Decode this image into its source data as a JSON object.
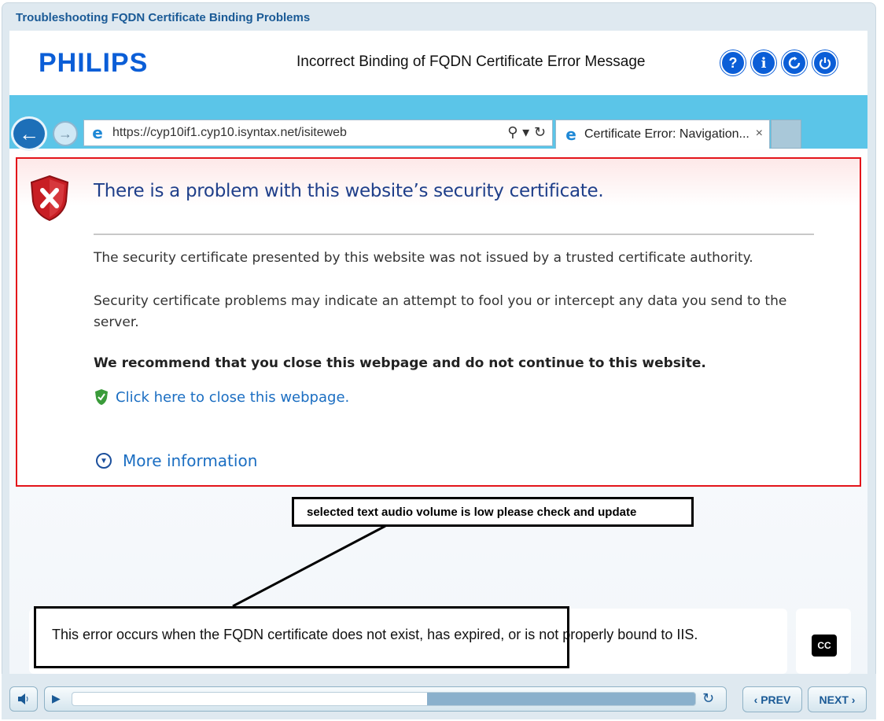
{
  "course": {
    "title": "Troubleshooting FQDN Certificate Binding Problems"
  },
  "header": {
    "logo": "PHILIPS",
    "slide_title": "Incorrect Binding of FQDN Certificate Error Message",
    "buttons": {
      "help": "?",
      "info": "i"
    }
  },
  "browser": {
    "url": "https://cyp10if1.cyp10.isyntax.net/isiteweb",
    "tab_label": "Certificate Error: Navigation...",
    "tab_close": "×"
  },
  "error_page": {
    "heading": "There is a problem with this website’s security certificate.",
    "paragraph1": "The security certificate presented by this website was not issued by a trusted certificate authority.",
    "paragraph2": "Security certificate problems may indicate an attempt to fool you or intercept any data you send to the server.",
    "recommendation": "We recommend that you close this webpage and do not continue to this website.",
    "close_link": "Click here to close this webpage.",
    "more_info": "More information"
  },
  "annotation": {
    "note": "selected text audio volume is low please check and update"
  },
  "caption": {
    "text": "This error occurs when the FQDN certificate does not exist, has expired, or is not properly bound to IIS.",
    "cc_label": "CC"
  },
  "player": {
    "progress_fraction": 0.57,
    "prev_label": "‹ PREV",
    "next_label": "NEXT ›"
  },
  "colors": {
    "brand_blue": "#0b5ed7",
    "error_red": "#e3141a",
    "ie_bar": "#5bc5e8",
    "link_blue": "#1b6ec2"
  }
}
